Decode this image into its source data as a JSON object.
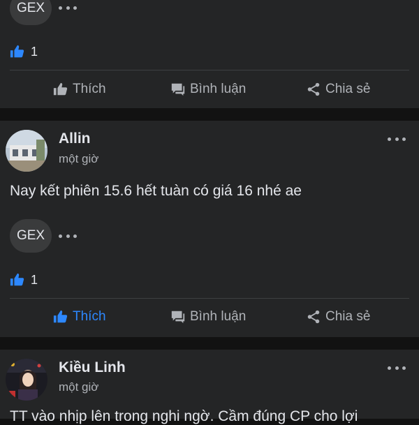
{
  "posts": [
    {
      "tag": "GEX",
      "like_count": "1",
      "actions": {
        "like": "Thích",
        "comment": "Bình luận",
        "share": "Chia sẻ"
      }
    },
    {
      "author": "Allin",
      "time": "một giờ",
      "text": "Nay kết phiên 15.6 hết tuàn có giá 16 nhé ae",
      "tag": "GEX",
      "like_count": "1",
      "liked": true,
      "actions": {
        "like": "Thích",
        "comment": "Bình luận",
        "share": "Chia sẻ"
      }
    },
    {
      "author": "Kiều Linh",
      "time": "một giờ",
      "text": "TT vào nhịp lên trong nghi ngờ. Cầm đúng CP cho lợi"
    }
  ],
  "colors": {
    "background": "#121212",
    "card": "#242526",
    "accent": "#2d88ff",
    "text": "#e4e6eb",
    "secondary_text": "#b0b3b8"
  },
  "icons": {
    "like": "thumbs-up-icon",
    "comment": "chat-bubble-icon",
    "share": "share-icon",
    "more": "more-dots-icon"
  }
}
